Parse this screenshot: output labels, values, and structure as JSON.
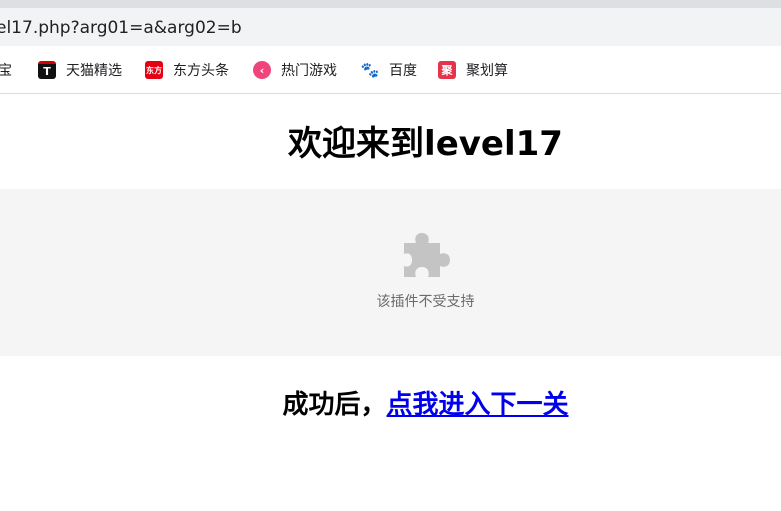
{
  "browser": {
    "address": "el17.php?arg01=a&arg02=b",
    "bookmarks": [
      {
        "label": "淘宝",
        "icon": "taobao-icon",
        "color": "#ff5000"
      },
      {
        "label": "天猫精选",
        "icon": "tmall-icon",
        "color": "#d50000"
      },
      {
        "label": "东方头条",
        "icon": "dongfang-icon",
        "color": "#e60012"
      },
      {
        "label": "热门游戏",
        "icon": "game-icon",
        "color": "#f0457c"
      },
      {
        "label": "百度",
        "icon": "baidu-icon",
        "color": "#2932e1"
      },
      {
        "label": "聚划算",
        "icon": "juhuasuan-icon",
        "color": "#e5344a"
      }
    ]
  },
  "page": {
    "title": "欢迎来到level17",
    "plugin_message": "该插件不受支持",
    "success_prefix": "成功后，",
    "next_level_link": "点我进入下一关"
  }
}
